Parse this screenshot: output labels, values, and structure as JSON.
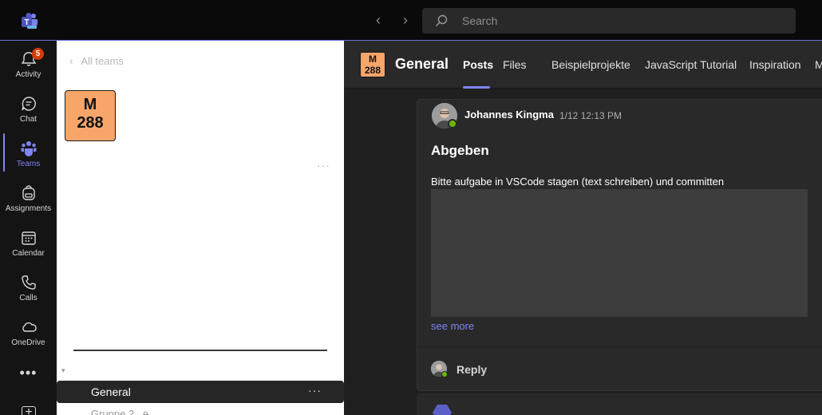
{
  "titlebar": {
    "back_glyph": "‹",
    "forward_glyph": "›",
    "search_placeholder": "Search",
    "icons": [
      "teams-logo-icon",
      "back-arrow-icon",
      "forward-arrow-icon",
      "search-icon"
    ]
  },
  "rail": {
    "items": [
      {
        "label": "Activity",
        "icon": "bell-icon",
        "badge": "5"
      },
      {
        "label": "Chat",
        "icon": "chat-icon"
      },
      {
        "label": "Teams",
        "icon": "teams-icon",
        "active": true
      },
      {
        "label": "Assignments",
        "icon": "backpack-icon"
      },
      {
        "label": "Calendar",
        "icon": "calendar-icon"
      },
      {
        "label": "Calls",
        "icon": "phone-icon"
      },
      {
        "label": "OneDrive",
        "icon": "cloud-icon"
      }
    ],
    "more_glyph": "•••",
    "add_glyph": "+"
  },
  "team_panel": {
    "back_glyph": "‹",
    "back_label": "All teams",
    "team_avatar": {
      "line1": "M",
      "line2": "288"
    },
    "more_glyph": "···",
    "caret_glyph": "▾",
    "channels": [
      {
        "label": "General",
        "active": true,
        "more_glyph": "···"
      },
      {
        "label": "Gruppe 2",
        "private": true
      }
    ]
  },
  "channel_header": {
    "avatar": {
      "line1": "M",
      "line2": "288"
    },
    "title": "General",
    "tabs": [
      "Posts",
      "Files",
      "Beispielprojekte",
      "JavaScript Tutorial",
      "Inspiration",
      "M"
    ],
    "active_tab": "Posts"
  },
  "post": {
    "author": "Johannes Kingma",
    "timestamp": "1/12 12:13 PM",
    "subject": "Abgeben",
    "body": "Bitte aufgabe in VSCode stagen (text schreiben) und committen",
    "see_more": "see more",
    "reply_label": "Reply",
    "presence_status": "available"
  },
  "colors": {
    "accent": "#7f85f5",
    "badge": "#d83b01",
    "team_orange": "#f7a568",
    "presence_green": "#6bb700"
  }
}
